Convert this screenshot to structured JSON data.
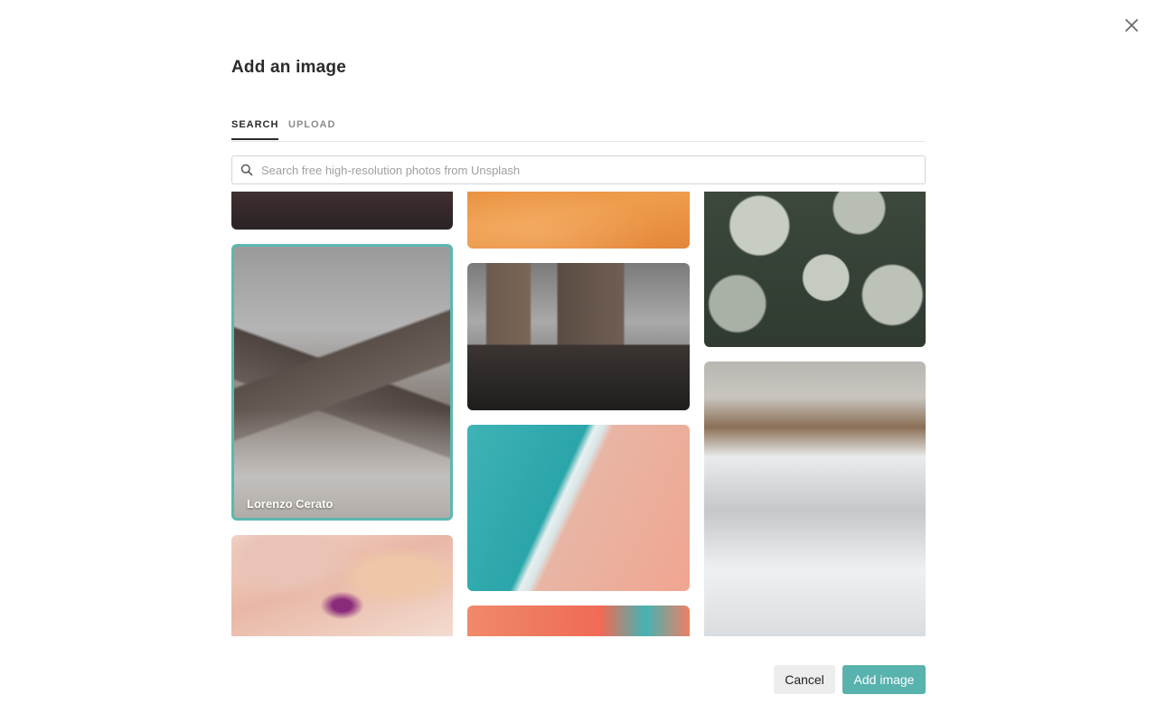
{
  "dialog": {
    "title": "Add an image",
    "close_icon": "close-icon"
  },
  "tabs": [
    {
      "label": "SEARCH",
      "active": true
    },
    {
      "label": "UPLOAD",
      "active": false
    }
  ],
  "search": {
    "placeholder": "Search free high-resolution photos from Unsplash",
    "value": "",
    "icon": "search-icon"
  },
  "photos": [
    {
      "id": "photo-dark-rock",
      "selected": false,
      "credit": ""
    },
    {
      "id": "photo-mountain-cerato",
      "selected": true,
      "credit": "Lorenzo Cerato"
    },
    {
      "id": "photo-marble",
      "selected": false,
      "credit": ""
    },
    {
      "id": "photo-desert",
      "selected": false,
      "credit": ""
    },
    {
      "id": "photo-city",
      "selected": false,
      "credit": ""
    },
    {
      "id": "photo-beach",
      "selected": false,
      "credit": ""
    },
    {
      "id": "photo-coral",
      "selected": false,
      "credit": ""
    },
    {
      "id": "photo-plants",
      "selected": false,
      "credit": ""
    },
    {
      "id": "photo-snow-mountain",
      "selected": false,
      "credit": ""
    }
  ],
  "footer": {
    "cancel_label": "Cancel",
    "add_label": "Add image"
  },
  "colors": {
    "accent": "#58b2ad",
    "selected_border": "#5bb8b0"
  }
}
